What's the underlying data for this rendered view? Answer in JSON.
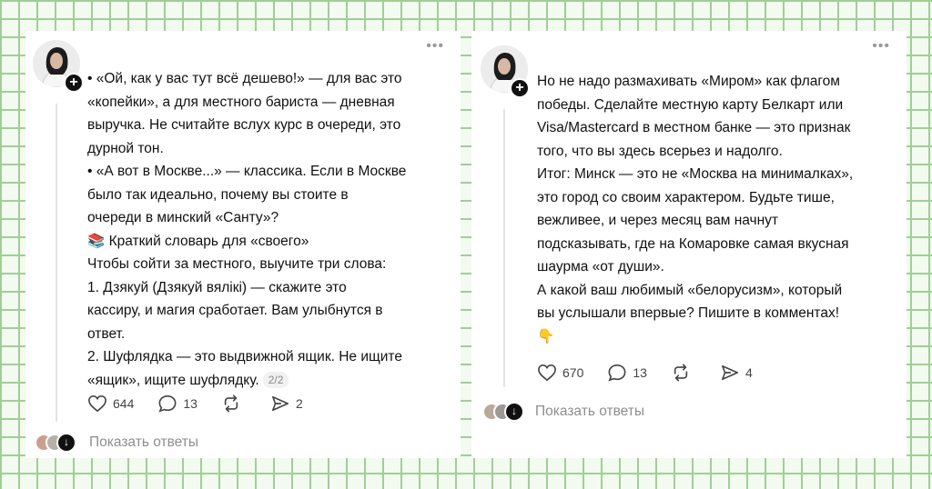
{
  "left_post": {
    "lines": [
      "• «Ой, как у вас тут всё дешево!» — для вас это",
      "«копейки», а для местного бариста — дневная",
      "выручка. Не считайте вслух курс в очереди, это",
      "дурной тон.",
      "• «А вот в Москве...» — классика. Если в Москве",
      "было так идеально, почему вы стоите в",
      "очереди в минский «Санту»?",
      "📚 Краткий словарь для «своего»",
      "Чтобы сойти за местного, выучите три слова:",
      "1. Дзякуй (Дзякуй вялікі) — скажите это",
      "кассиру, и магия сработает. Вам улыбнутся в",
      "ответ.",
      "2. Шуфлядка — это выдвижной ящик. Не ищите",
      "«ящик», ищите шуфлядку."
    ],
    "page_badge": "2/2",
    "likes": "644",
    "comments": "13",
    "reposts": "",
    "shares": "2",
    "replies_label": "Показать ответы"
  },
  "right_post": {
    "lines": [
      "Но не надо размахивать «Миром» как флагом",
      "победы. Сделайте местную карту Белкарт или",
      "Visa/Mastercard в местном банке — это признак",
      "того, что вы здесь всерьез и надолго.",
      "Итог: Минск — это не «Москва на минималках»,",
      "это город со своим характером. Будьте тише,",
      "вежливее, и через месяц вам начнут",
      "подсказывать, где на Комаровке самая вкусная",
      "шаурма «от души».",
      "А какой ваш любимый «белорусизм», который",
      "вы услышали впервые? Пишите в комментах!",
      "👇"
    ],
    "likes": "670",
    "comments": "13",
    "shares": "4",
    "replies_label": "Показать ответы"
  },
  "icons": {
    "more": "more-dots-icon",
    "like": "heart-icon",
    "comment": "comment-bubble-icon",
    "repost": "repost-icon",
    "share": "send-icon",
    "follow": "plus-icon",
    "expand": "arrow-down-icon"
  },
  "colors": {
    "background": "#f3faf0",
    "grid": "#9fcf96",
    "card": "#ffffff",
    "text": "#111111",
    "muted": "#8e8e8e"
  }
}
